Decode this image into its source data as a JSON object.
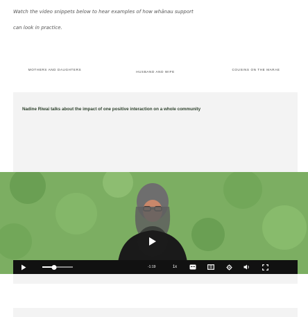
{
  "intro": {
    "line1": "Watch the video snippets below to hear examples of how whānau support",
    "line2": "can look in practice."
  },
  "tabs": [
    {
      "label": "MOTHERS AND DAUGHTERS"
    },
    {
      "label": "HUSBAND AND WIFE"
    },
    {
      "label": "COUSINS ON THE MARAE"
    }
  ],
  "video_card": {
    "caption": "Nadine Riwai talks about the impact of one positive interaction on a whole community"
  },
  "player": {
    "progress": 0.38,
    "time_display": "-1:19",
    "controls": {
      "play_icon": "play-icon",
      "volume_icon": "volume-icon",
      "speed_label": "1x",
      "captions_icon": "captions-icon",
      "chapters_icon": "chapters-icon",
      "settings_icon": "gear-icon",
      "fullscreen_icon": "fullscreen-icon"
    }
  },
  "colors": {
    "background_foliage": "#7cae62",
    "controls_bar": "#111111",
    "card_bg": "#f3f3f3"
  }
}
